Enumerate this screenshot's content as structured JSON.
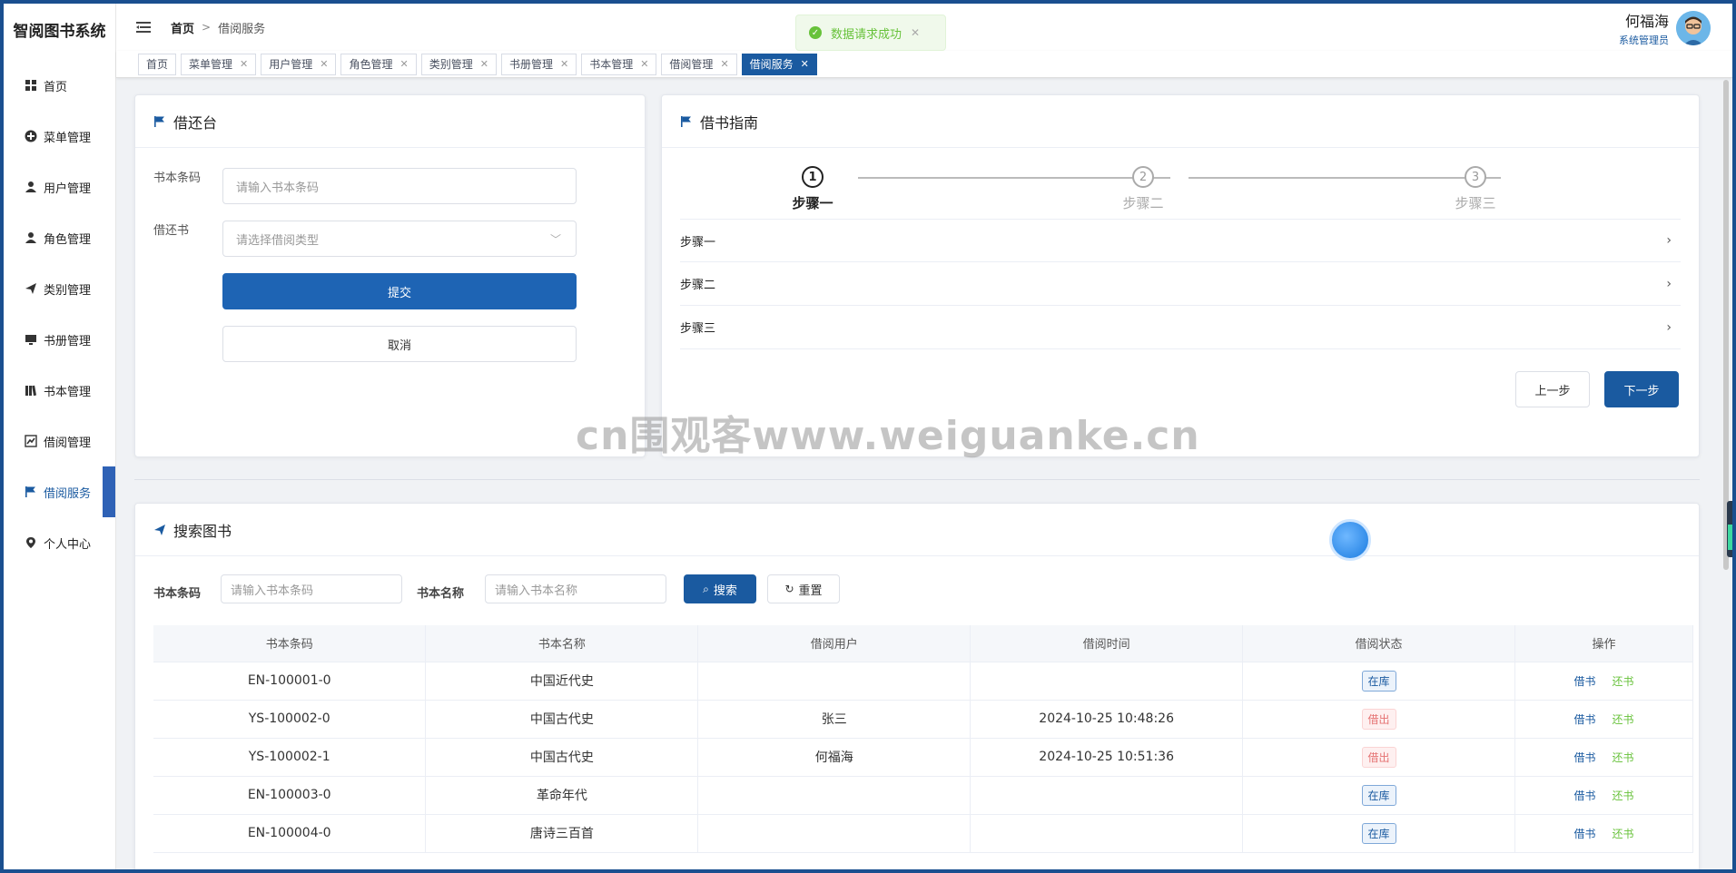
{
  "app": {
    "title": "智阅图书系统"
  },
  "sidebar": {
    "items": [
      {
        "label": "首页",
        "icon": "grid-icon"
      },
      {
        "label": "菜单管理",
        "icon": "plus-circle-icon"
      },
      {
        "label": "用户管理",
        "icon": "user-icon"
      },
      {
        "label": "角色管理",
        "icon": "user-icon"
      },
      {
        "label": "类别管理",
        "icon": "send-icon"
      },
      {
        "label": "书册管理",
        "icon": "monitor-icon"
      },
      {
        "label": "书本管理",
        "icon": "books-icon"
      },
      {
        "label": "借阅管理",
        "icon": "chart-icon"
      },
      {
        "label": "借阅服务",
        "icon": "flag-icon",
        "active": true
      },
      {
        "label": "个人中心",
        "icon": "pin-icon"
      }
    ]
  },
  "header": {
    "breadcrumb_home": "首页",
    "breadcrumb_current": "借阅服务",
    "user_name": "何福海",
    "user_role": "系统管理员"
  },
  "toast": {
    "message": "数据请求成功"
  },
  "tabs": [
    {
      "label": "首页",
      "closable": false
    },
    {
      "label": "菜单管理",
      "closable": true
    },
    {
      "label": "用户管理",
      "closable": true
    },
    {
      "label": "角色管理",
      "closable": true
    },
    {
      "label": "类别管理",
      "closable": true
    },
    {
      "label": "书册管理",
      "closable": true
    },
    {
      "label": "书本管理",
      "closable": true
    },
    {
      "label": "借阅管理",
      "closable": true
    },
    {
      "label": "借阅服务",
      "closable": true,
      "active": true
    }
  ],
  "borrow_desk": {
    "title": "借还台",
    "barcode_label": "书本条码",
    "barcode_placeholder": "请输入书本条码",
    "type_label": "借还书",
    "type_placeholder": "请选择借阅类型",
    "submit": "提交",
    "cancel": "取消"
  },
  "guide": {
    "title": "借书指南",
    "steps": [
      {
        "num": "1",
        "title": "步骤一",
        "status": "done"
      },
      {
        "num": "2",
        "title": "步骤二",
        "status": "wait"
      },
      {
        "num": "3",
        "title": "步骤三",
        "status": "wait"
      }
    ],
    "rows": [
      "步骤一",
      "步骤二",
      "步骤三"
    ],
    "prev": "上一步",
    "next": "下一步"
  },
  "search": {
    "title": "搜索图书",
    "barcode_label": "书本条码",
    "barcode_placeholder": "请输入书本条码",
    "name_label": "书本名称",
    "name_placeholder": "请输入书本名称",
    "search_btn": "搜索",
    "reset_btn": "重置"
  },
  "table": {
    "columns": [
      "书本条码",
      "书本名称",
      "借阅用户",
      "借阅时间",
      "借阅状态",
      "操作"
    ],
    "rows": [
      {
        "code": "EN-100001-0",
        "name": "中国近代史",
        "user": "",
        "time": "",
        "status": "在库",
        "status_type": "in"
      },
      {
        "code": "YS-100002-0",
        "name": "中国古代史",
        "user": "张三",
        "time": "2024-10-25 10:48:26",
        "status": "借出",
        "status_type": "out"
      },
      {
        "code": "YS-100002-1",
        "name": "中国古代史",
        "user": "何福海",
        "time": "2024-10-25 10:51:36",
        "status": "借出",
        "status_type": "out"
      },
      {
        "code": "EN-100003-0",
        "name": "革命年代",
        "user": "",
        "time": "",
        "status": "在库",
        "status_type": "in"
      },
      {
        "code": "EN-100004-0",
        "name": "唐诗三百首",
        "user": "",
        "time": "",
        "status": "在库",
        "status_type": "in"
      }
    ],
    "op_borrow": "借书",
    "op_return": "还书"
  },
  "watermark": "cn围观客www.weiguanke.cn",
  "colors": {
    "primary": "#1e64b4",
    "success": "#67c23a",
    "danger": "#e57373"
  }
}
